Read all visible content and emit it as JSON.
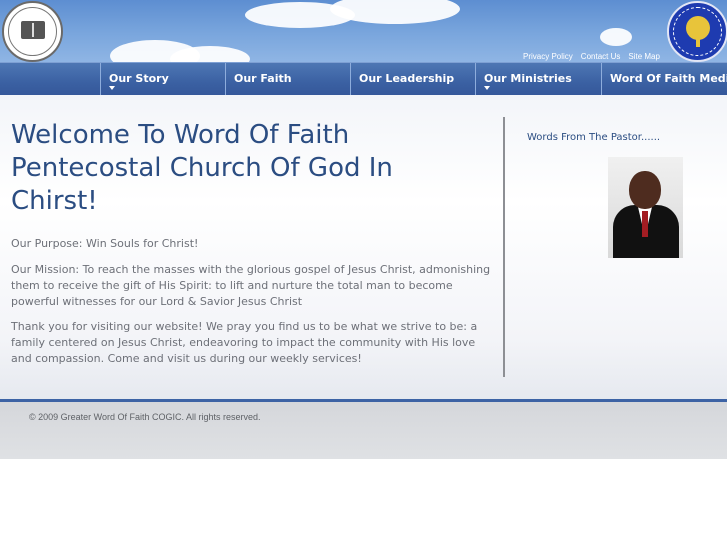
{
  "header": {
    "util_links": [
      "Privacy Policy",
      "Contact Us",
      "Site Map"
    ]
  },
  "nav": {
    "items": [
      {
        "label": "Our Story"
      },
      {
        "label": "Our Faith"
      },
      {
        "label": "Our Leadership"
      },
      {
        "label": "Our Ministries"
      },
      {
        "label": "Word Of Faith Media"
      }
    ]
  },
  "main": {
    "title": "Welcome To Word Of Faith Pentecostal Church Of God In Chirst!",
    "purpose": "Our Purpose: Win Souls for Christ!",
    "mission": "Our Mission: To reach the masses with the glorious  gospel of Jesus Christ, admonishing them to receive the gift of His Spirit: to lift and nurture the total man to become powerful witnesses for our Lord & Savior Jesus Christ",
    "thanks": "Thank you for visiting our website!  We pray you find us to be what we strive to be: a family centered on Jesus Christ, endeavoring to impact the community with His love and compassion. Come and visit us during our weekly services!"
  },
  "sidebar": {
    "heading": "Words From The Pastor......"
  },
  "footer": {
    "copyright": "© 2009 Greater Word Of Faith COGIC. All rights reserved."
  },
  "colors": {
    "nav_background": "#3b61a3",
    "title_text": "#2b4d82",
    "body_text": "#6d7078",
    "footer_background": "#d9dbde"
  }
}
